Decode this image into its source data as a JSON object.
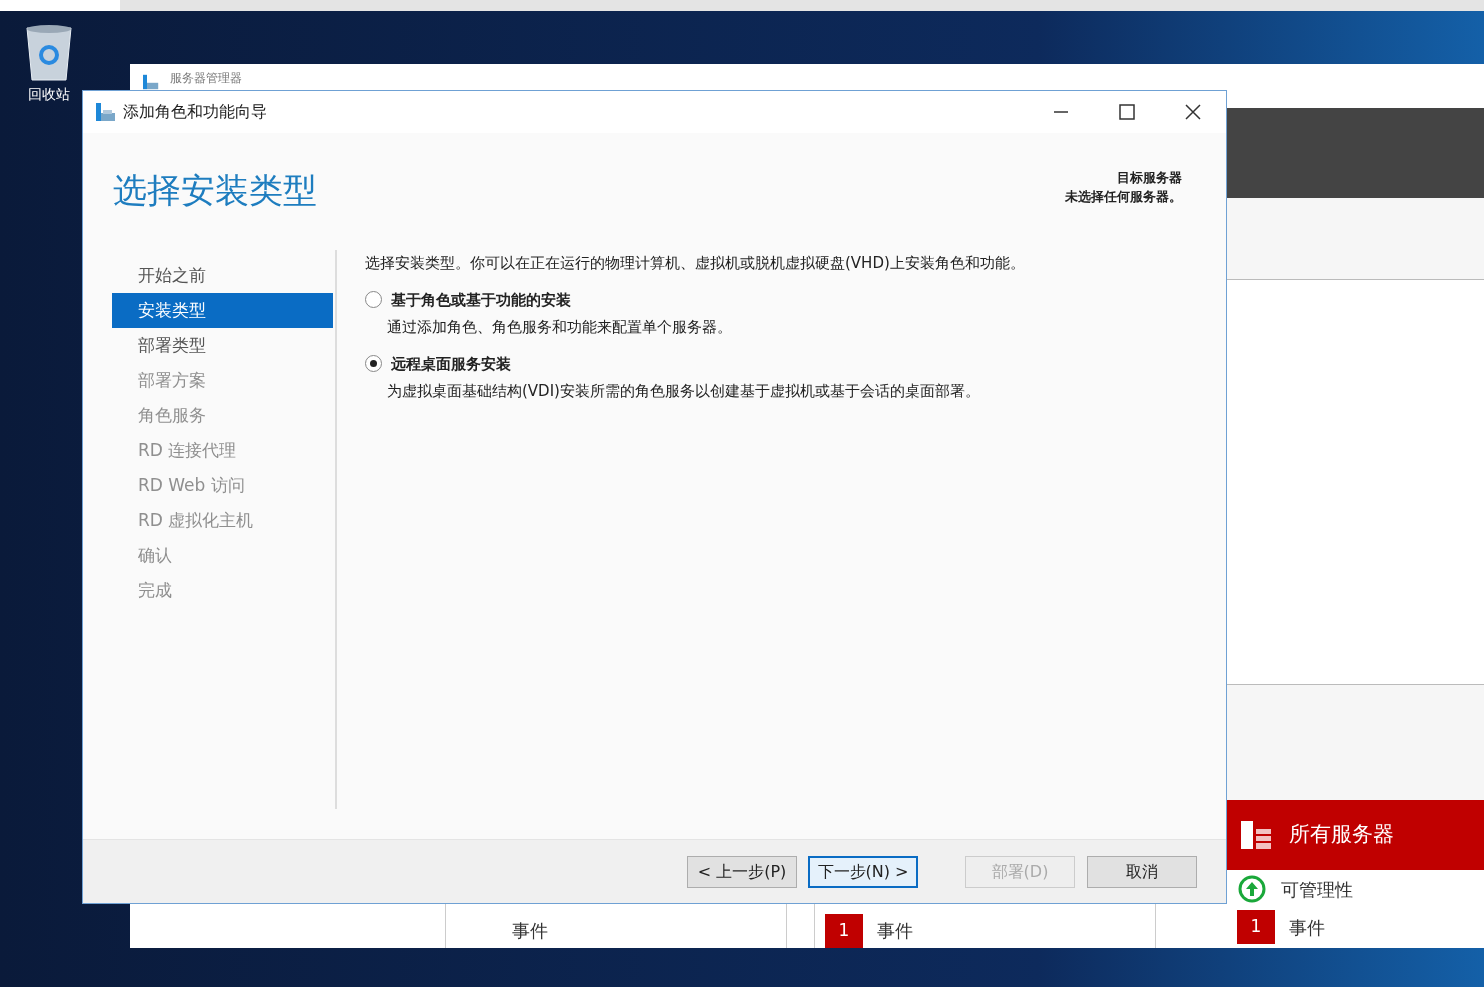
{
  "desktop": {
    "icons": [
      {
        "label": "回收站"
      }
    ]
  },
  "server_manager": {
    "title": "服务器管理器",
    "tiles": [
      {
        "label": "事件"
      },
      {
        "badge": "1",
        "label": "事件"
      }
    ],
    "all_servers": {
      "title": "所有服务器",
      "manageability": "可管理性",
      "badge": "1",
      "events": "事件"
    }
  },
  "dialog": {
    "title": "添加角色和功能向导",
    "heading": "选择安装类型",
    "target_server": {
      "label": "目标服务器",
      "value": "未选择任何服务器。"
    },
    "steps": [
      {
        "label": "开始之前",
        "selected": false,
        "disabled": false
      },
      {
        "label": "安装类型",
        "selected": true,
        "disabled": false
      },
      {
        "label": "部署类型",
        "selected": false,
        "disabled": false
      },
      {
        "label": "部署方案",
        "selected": false,
        "disabled": true
      },
      {
        "label": "角色服务",
        "selected": false,
        "disabled": true
      },
      {
        "label": "RD 连接代理",
        "selected": false,
        "disabled": true
      },
      {
        "label": "RD Web 访问",
        "selected": false,
        "disabled": true
      },
      {
        "label": "RD 虚拟化主机",
        "selected": false,
        "disabled": true
      },
      {
        "label": "确认",
        "selected": false,
        "disabled": true
      },
      {
        "label": "完成",
        "selected": false,
        "disabled": true
      }
    ],
    "intro": "选择安装类型。你可以在正在运行的物理计算机、虚拟机或脱机虚拟硬盘(VHD)上安装角色和功能。",
    "options": [
      {
        "title": "基于角色或基于功能的安装",
        "description": "通过添加角色、角色服务和功能来配置单个服务器。",
        "selected": false
      },
      {
        "title": "远程桌面服务安装",
        "description": "为虚拟桌面基础结构(VDI)安装所需的角色服务以创建基于虚拟机或基于会话的桌面部署。",
        "selected": true
      }
    ],
    "buttons": [
      {
        "label": "< 上一步(P)",
        "disabled": false,
        "focused": false
      },
      {
        "label": "下一步(N) >",
        "disabled": false,
        "focused": true
      },
      {
        "label": "部署(D)",
        "disabled": true,
        "focused": false
      },
      {
        "label": "取消",
        "disabled": false,
        "focused": false
      }
    ]
  }
}
